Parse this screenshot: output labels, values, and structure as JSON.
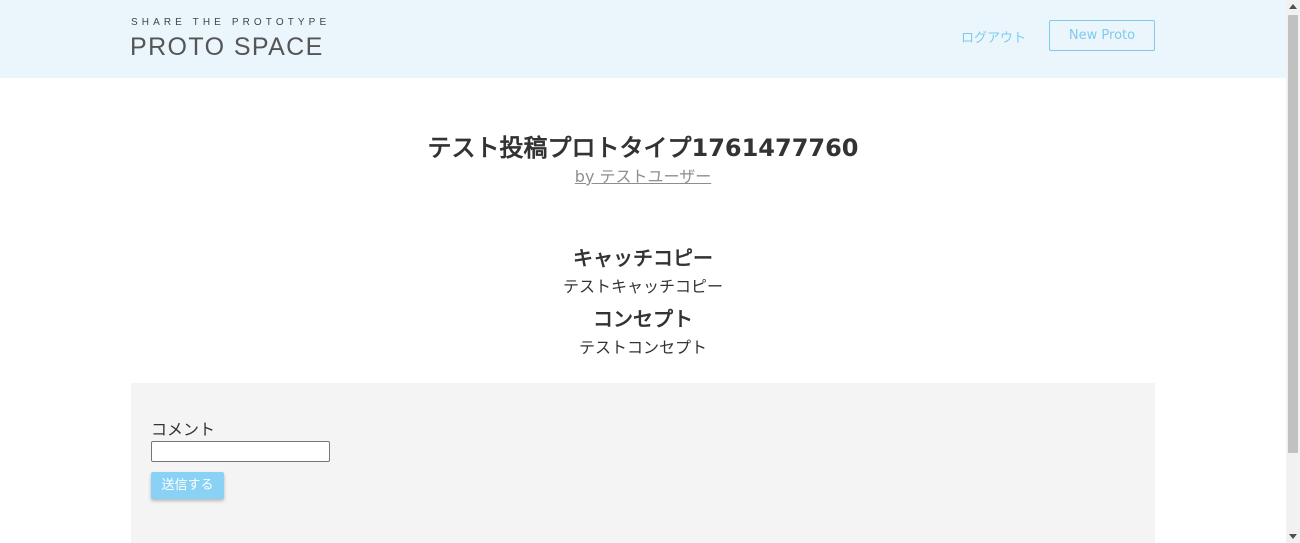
{
  "header": {
    "logo": {
      "tagline": "SHARE THE PROTOTYPE",
      "name_part1": "PROTO",
      "name_accent": "",
      "name_part2": "SPACE"
    },
    "logout_label": "ログアウト",
    "new_proto_label": "New Proto"
  },
  "prototype": {
    "title": "テスト投稿プロトタイプ1761477760",
    "author_prefix": "by",
    "author_name": "テストユーザー"
  },
  "sections": [
    {
      "heading": "キャッチコピー",
      "text": "テストキャッチコピー"
    },
    {
      "heading": "コンセプト",
      "text": "テストコンセプト"
    }
  ],
  "comment": {
    "label": "コメント",
    "input_value": "",
    "submit_label": "送信する"
  },
  "colors": {
    "header_bg": "#ebf6fc",
    "accent": "#7ecbeb",
    "button_bg": "#89d2f5",
    "panel_bg": "#f4f4f4"
  }
}
